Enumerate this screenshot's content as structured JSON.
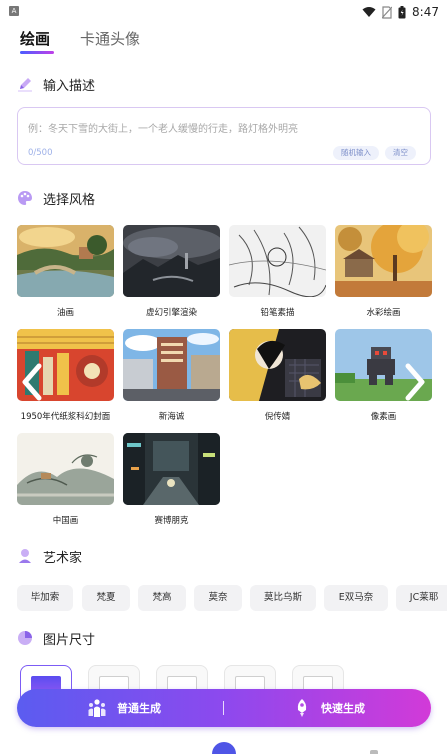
{
  "status_bar": {
    "time": "8:47"
  },
  "tabs": [
    {
      "label": "绘画"
    },
    {
      "label": "卡通头像"
    }
  ],
  "description": {
    "title": "输入描述",
    "placeholder": "例：冬天下雪的大街上，一个老人缓慢的行走，路灯格外明亮",
    "count": "0/500",
    "random_button": "随机输入",
    "clear_button": "清空"
  },
  "styles": {
    "title": "选择风格",
    "items": [
      {
        "label": "油画"
      },
      {
        "label": "虚幻引擎渲染"
      },
      {
        "label": "铅笔素描"
      },
      {
        "label": "水彩绘画"
      },
      {
        "label": "1950年代纸浆科幻封面"
      },
      {
        "label": "新海诚"
      },
      {
        "label": "倪传婧"
      },
      {
        "label": "像素画"
      },
      {
        "label": "中国画"
      },
      {
        "label": "赛博朋克"
      }
    ]
  },
  "artists": {
    "title": "艺术家",
    "items": [
      {
        "label": "毕加索"
      },
      {
        "label": "梵夏"
      },
      {
        "label": "梵高"
      },
      {
        "label": "莫奈"
      },
      {
        "label": "莫比乌斯"
      },
      {
        "label": "E双马奈"
      },
      {
        "label": "JC莱耶"
      }
    ]
  },
  "image_size": {
    "title": "图片尺寸"
  },
  "generate": {
    "normal_label": "普通生成",
    "fast_label": "快速生成"
  },
  "colors": {
    "accent_start": "#5b5cf0",
    "accent_mid": "#8d49ee",
    "accent_end": "#d23ad8"
  }
}
